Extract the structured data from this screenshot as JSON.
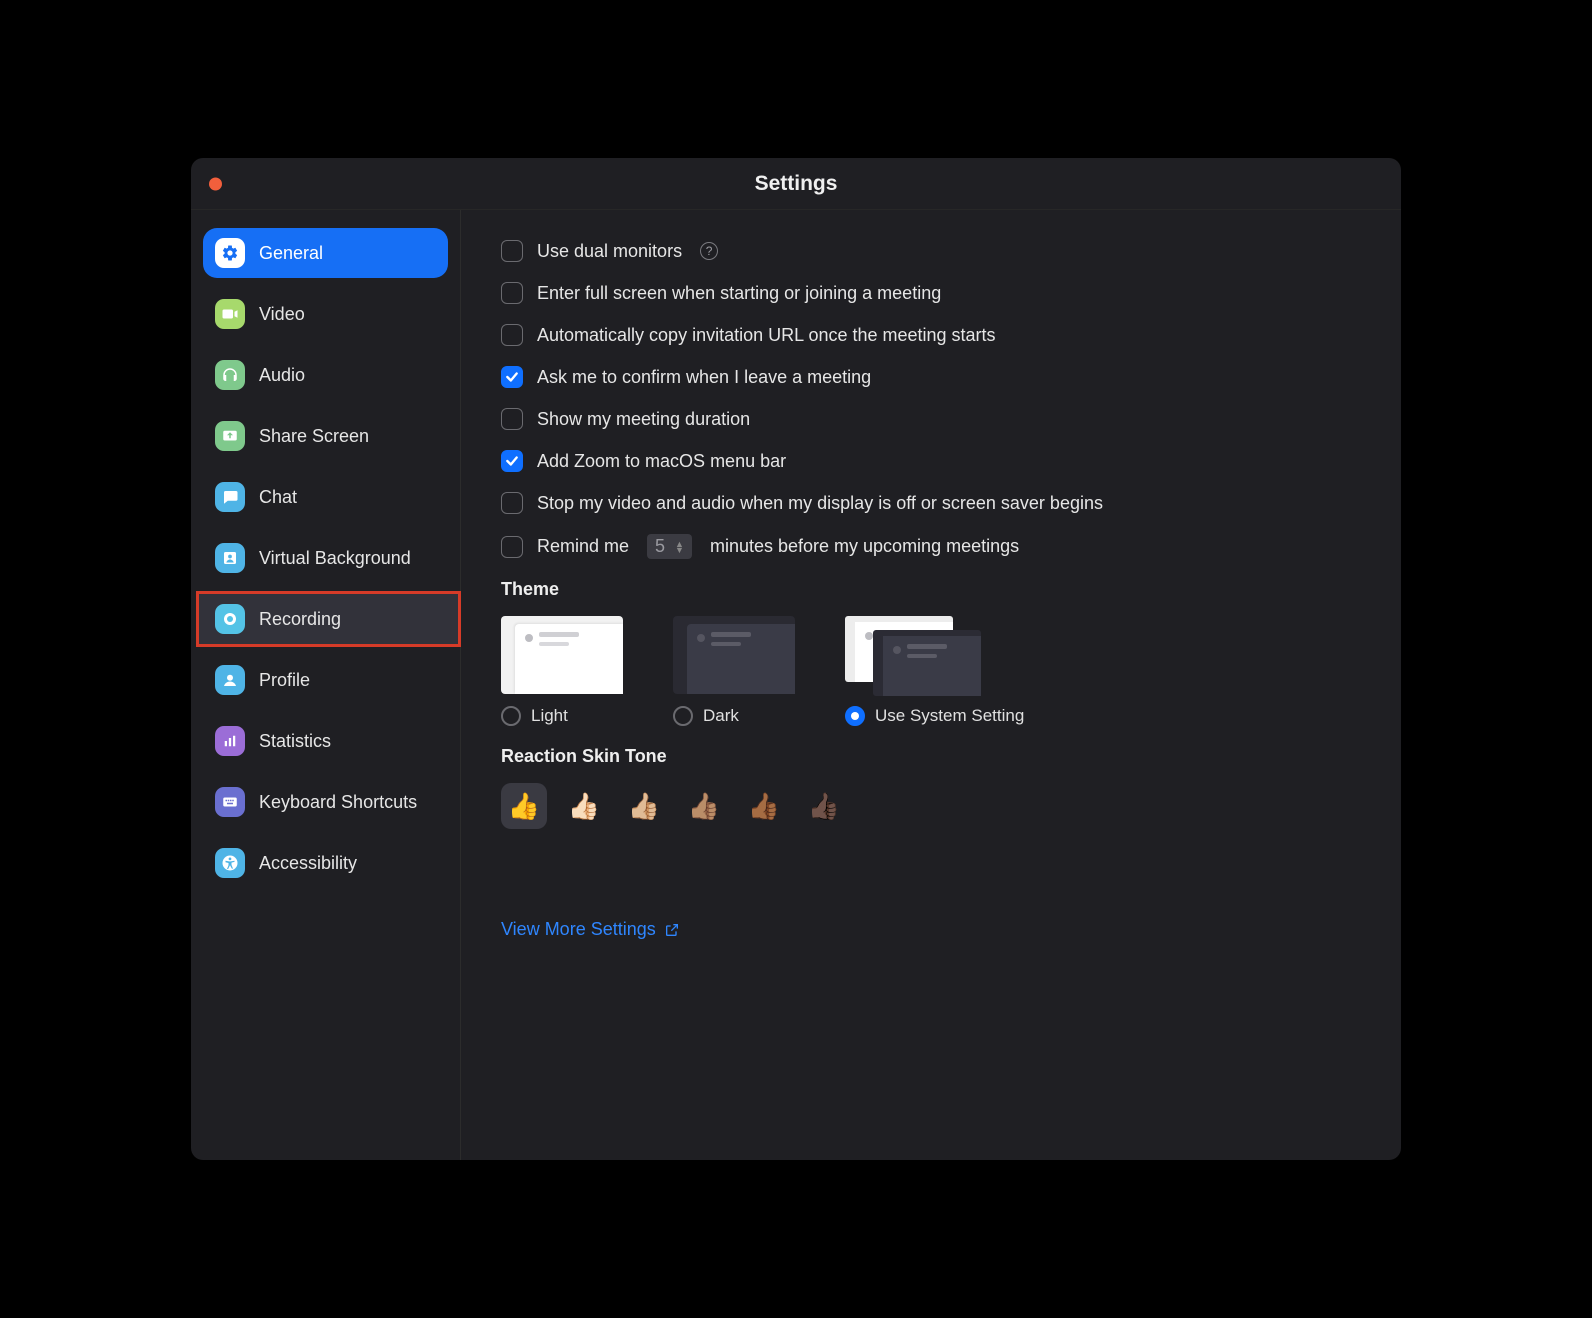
{
  "window_title": "Settings",
  "sidebar": {
    "items": [
      {
        "label": "General",
        "icon": "gear-icon",
        "selected": true,
        "highlighted": false
      },
      {
        "label": "Video",
        "icon": "video-icon",
        "selected": false,
        "highlighted": false
      },
      {
        "label": "Audio",
        "icon": "headphones-icon",
        "selected": false,
        "highlighted": false
      },
      {
        "label": "Share Screen",
        "icon": "share-screen-icon",
        "selected": false,
        "highlighted": false
      },
      {
        "label": "Chat",
        "icon": "chat-icon",
        "selected": false,
        "highlighted": false
      },
      {
        "label": "Virtual Background",
        "icon": "virtual-background-icon",
        "selected": false,
        "highlighted": false
      },
      {
        "label": "Recording",
        "icon": "recording-icon",
        "selected": false,
        "highlighted": true
      },
      {
        "label": "Profile",
        "icon": "profile-icon",
        "selected": false,
        "highlighted": false
      },
      {
        "label": "Statistics",
        "icon": "statistics-icon",
        "selected": false,
        "highlighted": false
      },
      {
        "label": "Keyboard Shortcuts",
        "icon": "keyboard-icon",
        "selected": false,
        "highlighted": false
      },
      {
        "label": "Accessibility",
        "icon": "accessibility-icon",
        "selected": false,
        "highlighted": false
      }
    ]
  },
  "general": {
    "options": [
      {
        "label": "Use dual monitors",
        "checked": false,
        "help": true
      },
      {
        "label": "Enter full screen when starting or joining a meeting",
        "checked": false
      },
      {
        "label": "Automatically copy invitation URL once the meeting starts",
        "checked": false
      },
      {
        "label": "Ask me to confirm when I leave a meeting",
        "checked": true
      },
      {
        "label": "Show my meeting duration",
        "checked": false
      },
      {
        "label": "Add Zoom to macOS menu bar",
        "checked": true
      },
      {
        "label": "Stop my video and audio when my display is off or screen saver begins",
        "checked": false
      }
    ],
    "remind_prefix": "Remind me",
    "remind_value": "5",
    "remind_suffix": "minutes before my upcoming meetings",
    "remind_checked": false,
    "theme_title": "Theme",
    "themes": [
      {
        "label": "Light",
        "selected": false
      },
      {
        "label": "Dark",
        "selected": false
      },
      {
        "label": "Use System Setting",
        "selected": true
      }
    ],
    "skin_title": "Reaction Skin Tone",
    "skin_tones": [
      "👍",
      "👍🏻",
      "👍🏼",
      "👍🏽",
      "👍🏾",
      "👍🏿"
    ],
    "skin_selected_index": 0,
    "more_link": "View More Settings"
  }
}
